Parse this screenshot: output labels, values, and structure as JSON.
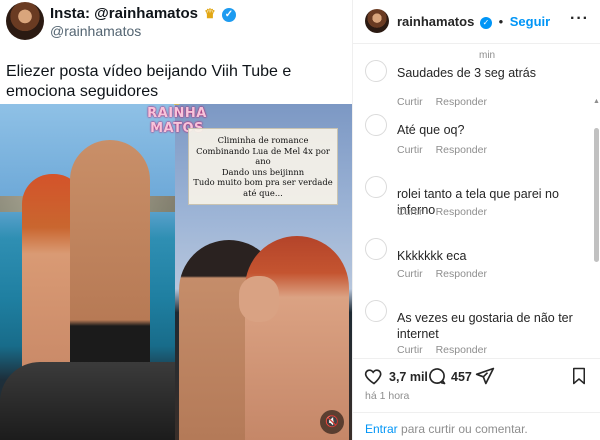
{
  "tweet": {
    "display_name": "Insta: @rainhamatos",
    "handle": "@rainhamatos",
    "text": "Eliezer posta vídeo beijando Viih Tube e emociona seguidores",
    "watermark": "RAINHA MATOS",
    "caption_lines": [
      "Climinha de romance",
      "Combinando Lua de Mel 4x por ano",
      "Dando uns beijinnn",
      "Tudo muito bom pra ser verdade",
      "até que..."
    ]
  },
  "instagram": {
    "username": "rainhamatos",
    "follow_label": "Seguir",
    "comments": [
      {
        "time": "min",
        "text": "Saudades de 3 seg atrás",
        "reply_label": "Curtir",
        "respond_label": "Responder"
      },
      {
        "time": "",
        "text": "Até que oq?",
        "reply_label": "Curtir",
        "respond_label": "Responder"
      },
      {
        "time": "",
        "text": "rolei tanto a tela que parei no inferno",
        "reply_label": "Curtir",
        "respond_label": "Responder"
      },
      {
        "time": "",
        "text": "Kkkkkkk eca",
        "reply_label": "Curtir",
        "respond_label": "Responder"
      },
      {
        "time": "",
        "text": "As vezes eu gostaria de não ter internet",
        "reply_label": "Curtir",
        "respond_label": "Responder"
      }
    ],
    "likes": "3,7 mil",
    "comment_count": "457",
    "posted": "há 1 hora",
    "footer_link": "Entrar",
    "footer_text": "para curtir ou comentar."
  },
  "colors": {
    "twitter_blue": "#1d9bf0",
    "instagram_blue": "#0095f6"
  },
  "icons": [
    "verified-badge-icon",
    "crown-icon",
    "heart-icon",
    "comment-icon",
    "share-icon",
    "bookmark-icon",
    "more-icon",
    "mute-icon"
  ]
}
